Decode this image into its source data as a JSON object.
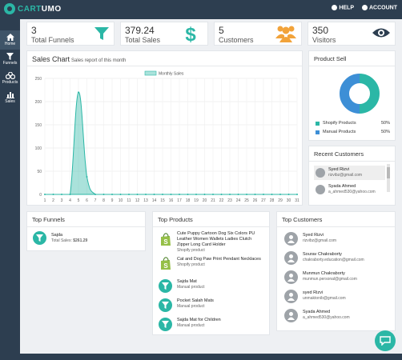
{
  "brand": {
    "part1": "CART",
    "part2": "UMO"
  },
  "top_actions": {
    "help": "HELP",
    "account": "ACCOUNT"
  },
  "sidebar": [
    {
      "label": "Home",
      "icon": "home-icon"
    },
    {
      "label": "Funnels",
      "icon": "funnel-icon"
    },
    {
      "label": "Products",
      "icon": "products-icon"
    },
    {
      "label": "Sales",
      "icon": "sales-chart-icon"
    }
  ],
  "stats": [
    {
      "value": "3",
      "label": "Total Funnels",
      "icon": "funnel-icon"
    },
    {
      "value": "379.24",
      "label": "Total Sales",
      "icon": "dollar-icon"
    },
    {
      "value": "5",
      "label": "Customers",
      "icon": "users-icon"
    },
    {
      "value": "350",
      "label": "Visitors",
      "icon": "eye-icon"
    }
  ],
  "sales_chart": {
    "title": "Sales Chart",
    "subtitle": "Sales report of this month"
  },
  "chart_data": {
    "type": "area",
    "series": [
      {
        "name": "Monthly Sales",
        "color": "#2bb7a6"
      }
    ],
    "x": [
      1,
      2,
      3,
      4,
      5,
      6,
      7,
      8,
      9,
      10,
      11,
      12,
      13,
      14,
      15,
      16,
      17,
      18,
      19,
      20,
      21,
      22,
      23,
      24,
      25,
      26,
      27,
      28,
      29,
      30,
      31
    ],
    "y": [
      0,
      0,
      0,
      0,
      220,
      38,
      0,
      0,
      0,
      0,
      0,
      0,
      0,
      0,
      0,
      0,
      0,
      0,
      0,
      0,
      0,
      0,
      0,
      0,
      0,
      0,
      0,
      0,
      0,
      0,
      0
    ],
    "yticks": [
      0,
      50,
      100,
      150,
      200,
      250
    ],
    "ylim": [
      0,
      250
    ],
    "grid": true,
    "legend": "top-center"
  },
  "product_sell": {
    "title": "Product Sell",
    "items": [
      {
        "label": "Shopify Products",
        "pct": "50%",
        "value": 50,
        "color": "#2bb7a6"
      },
      {
        "label": "Manual Products",
        "pct": "50%",
        "value": 50,
        "color": "#3d8fd6"
      }
    ]
  },
  "recent_customers": {
    "title": "Recent Customers",
    "items": [
      {
        "name": "Syed Rizvi",
        "email": "rizvibz@gmail.com"
      },
      {
        "name": "Syada Ahmed",
        "email": "a_ahmed530@yahoo.com"
      }
    ]
  },
  "top_funnels": {
    "title": "Top Funnels",
    "items": [
      {
        "name": "Sajda",
        "sales_label": "Total Sales:",
        "sales_value": "$261.29"
      }
    ]
  },
  "top_products": {
    "title": "Top Products",
    "items": [
      {
        "name": "Cute Puppy Cartoon Dog Six Colors PU Leather Women Wallets Ladies Clutch Zipper Long Card Holder",
        "type": "Shopify product",
        "icon": "shopify-icon"
      },
      {
        "name": "Cat and Dog Paw Print Pendant Necklaces",
        "type": "Shopify product",
        "icon": "shopify-icon"
      },
      {
        "name": "Sajda Mat",
        "type": "Manual product",
        "icon": "funnel-icon"
      },
      {
        "name": "Pocket Salah Mats",
        "type": "Manual product",
        "icon": "funnel-icon"
      },
      {
        "name": "Sajda Mat for Children",
        "type": "Manual product",
        "icon": "funnel-icon"
      }
    ]
  },
  "top_customers": {
    "title": "Top Customers",
    "items": [
      {
        "name": "Syed Rizvi",
        "email": "rizvibz@gmail.com"
      },
      {
        "name": "Sourav Chakraborty",
        "email": "chakraborty.education@gmail.com"
      },
      {
        "name": "Munmun Chakraborty",
        "email": "munmun.personal@gmail.com"
      },
      {
        "name": "syed Rizvi",
        "email": "unmaktonib@gmail.com"
      },
      {
        "name": "Syada Ahmed",
        "email": "a_ahmed530@yahoo.com"
      }
    ]
  }
}
